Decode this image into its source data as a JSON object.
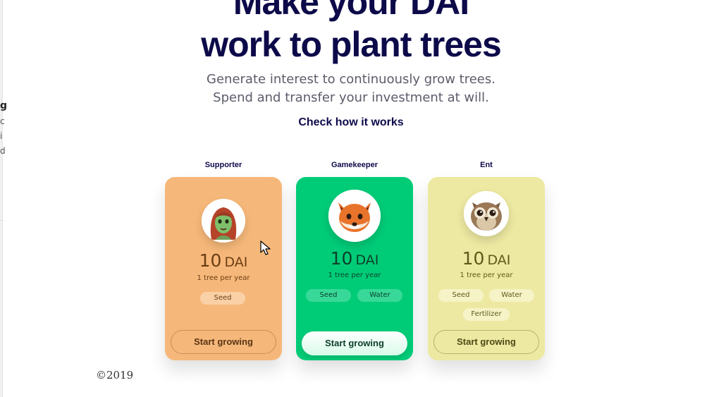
{
  "sidebar": {
    "fragments": [
      "g",
      "c",
      "i",
      "d"
    ]
  },
  "hero": {
    "title_line1": "Make your DAI",
    "title_line2": "work to plant trees",
    "subtitle_line1": "Generate interest to continuously grow trees.",
    "subtitle_line2": "Spend and transfer your investment at will.",
    "link_label": "Check how it works"
  },
  "tiers": [
    {
      "label": "Supporter",
      "amount": "10",
      "unit": "DAI",
      "rate": "1 tree per year",
      "tags": [
        "Seed"
      ],
      "button": "Start growing",
      "color": "#f6b87a",
      "avatar": "girl-memoji-icon"
    },
    {
      "label": "Gamekeeper",
      "amount": "10",
      "unit": "DAI",
      "rate": "1 tree per year",
      "tags": [
        "Seed",
        "Water"
      ],
      "button": "Start growing",
      "color": "#00cc78",
      "avatar": "fox-memoji-icon"
    },
    {
      "label": "Ent",
      "amount": "10",
      "unit": "DAI",
      "rate": "1 tree per year",
      "tags": [
        "Seed",
        "Water",
        "Fertilizer"
      ],
      "button": "Start growing",
      "color": "#ede9a2",
      "avatar": "owl-memoji-icon"
    }
  ],
  "footer": {
    "copyright": "©2019"
  },
  "colors": {
    "navy": "#0d0a4a",
    "orange": "#f6b87a",
    "green": "#00cc78",
    "yellow": "#ede9a2"
  }
}
